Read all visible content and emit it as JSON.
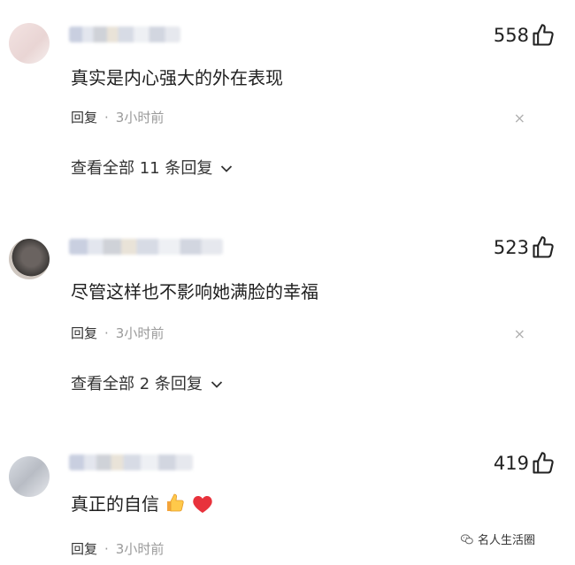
{
  "comments": [
    {
      "likes": "558",
      "text": "真实是内心强大的外在表现",
      "reply_label": "回复",
      "dot": "·",
      "time": "3小时前",
      "close": "×",
      "view_more": "查看全部 11 条回复"
    },
    {
      "likes": "523",
      "text": "尽管这样也不影响她满脸的幸福",
      "reply_label": "回复",
      "dot": "·",
      "time": "3小时前",
      "close": "×",
      "view_more": "查看全部 2 条回复"
    },
    {
      "likes": "419",
      "text": "真正的自信",
      "reply_label": "回复",
      "dot": "·",
      "time": "3小时前"
    }
  ],
  "watermark": {
    "text": "名人生活圈",
    "icon": "wechat-icon"
  },
  "icons": {
    "like": "thumbs-up-icon",
    "more": "chevron-down-icon"
  },
  "colors": {
    "text": "#1f1f1f",
    "muted": "#9a9a9a",
    "heart": "#e8323c"
  }
}
